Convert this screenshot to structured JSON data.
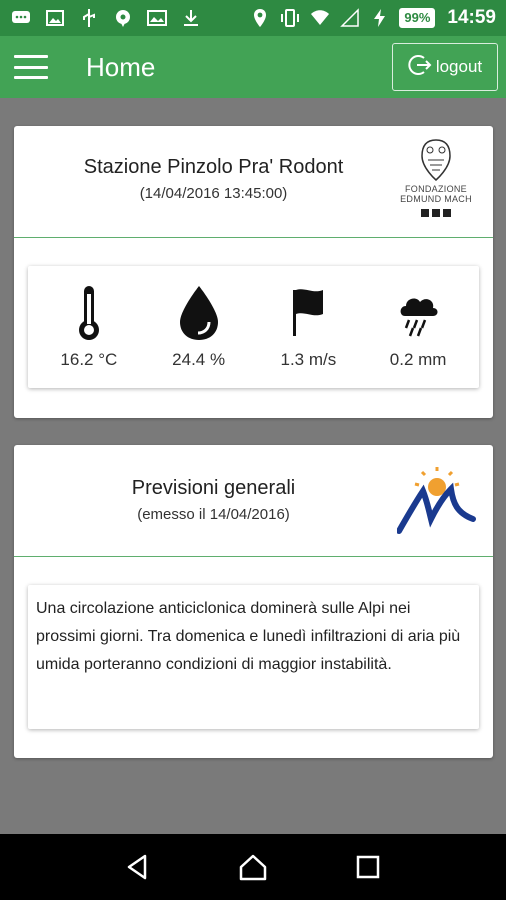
{
  "status_bar": {
    "battery": "99%",
    "time": "14:59"
  },
  "app_bar": {
    "title": "Home",
    "logout_label": "logout"
  },
  "station_card": {
    "title": "Stazione Pinzolo Pra' Rodont",
    "subtitle": "(14/04/2016 13:45:00)",
    "logo_text": "FONDAZIONE EDMUND MACH",
    "metrics": [
      {
        "icon": "thermometer-icon",
        "value": "16.2 °C"
      },
      {
        "icon": "water-drop-icon",
        "value": "24.4 %"
      },
      {
        "icon": "flag-icon",
        "value": "1.3 m/s"
      },
      {
        "icon": "rain-cloud-icon",
        "value": "0.2 mm"
      }
    ]
  },
  "forecast_card": {
    "title": "Previsioni generali",
    "subtitle": "(emesso il 14/04/2016)",
    "text": "Una circolazione anticiclonica dominerà sulle Alpi nei prossimi giorni. Tra domenica e lunedì infiltrazioni di aria più umida porteranno condizioni di maggior instabilità."
  },
  "colors": {
    "status_bar": "#2e8a42",
    "app_bar": "#42a355",
    "background": "#7a7a7a",
    "divider": "#5fae6e"
  }
}
